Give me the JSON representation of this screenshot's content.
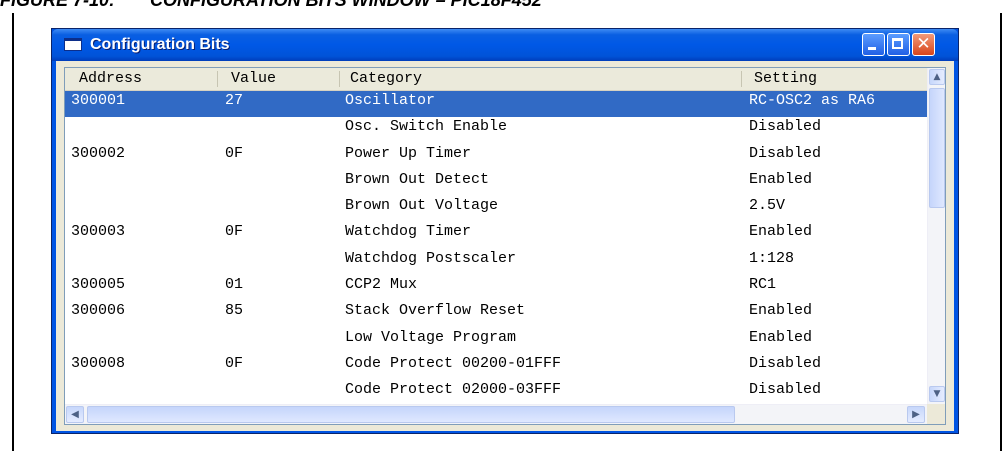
{
  "figure": {
    "caption": "FIGURE 7-10:       CONFIGURATION BITS WINDOW – PIC18F452"
  },
  "window": {
    "title": "Configuration Bits",
    "close_glyph": "✕"
  },
  "table": {
    "columns": [
      "Address",
      "Value",
      "Category",
      "Setting"
    ],
    "rows": [
      {
        "address": "300001",
        "value": "27",
        "category": "Oscillator",
        "setting": "RC-OSC2 as RA6",
        "selected": true
      },
      {
        "address": "",
        "value": "",
        "category": "Osc. Switch Enable",
        "setting": "Disabled"
      },
      {
        "address": "300002",
        "value": "0F",
        "category": "Power Up Timer",
        "setting": "Disabled"
      },
      {
        "address": "",
        "value": "",
        "category": "Brown Out Detect",
        "setting": "Enabled"
      },
      {
        "address": "",
        "value": "",
        "category": "Brown Out Voltage",
        "setting": "2.5V"
      },
      {
        "address": "300003",
        "value": "0F",
        "category": "Watchdog Timer",
        "setting": "Enabled"
      },
      {
        "address": "",
        "value": "",
        "category": "Watchdog Postscaler",
        "setting": "1:128"
      },
      {
        "address": "300005",
        "value": "01",
        "category": "CCP2 Mux",
        "setting": "RC1"
      },
      {
        "address": "300006",
        "value": "85",
        "category": "Stack Overflow Reset",
        "setting": "Enabled"
      },
      {
        "address": "",
        "value": "",
        "category": "Low Voltage Program",
        "setting": "Enabled"
      },
      {
        "address": "300008",
        "value": "0F",
        "category": "Code Protect 00200-01FFF",
        "setting": "Disabled"
      },
      {
        "address": "",
        "value": "",
        "category": "Code Protect 02000-03FFF",
        "setting": "Disabled"
      }
    ]
  },
  "colors": {
    "selection": "#316ac5",
    "titlebar": "#0058e6"
  },
  "icons": {
    "window": "window-icon",
    "minimize": "minimize-icon",
    "maximize": "maximize-icon",
    "close": "close-icon",
    "scroll_up": "chevron-up-icon",
    "scroll_down": "chevron-down-icon",
    "scroll_left": "chevron-left-icon",
    "scroll_right": "chevron-right-icon"
  }
}
